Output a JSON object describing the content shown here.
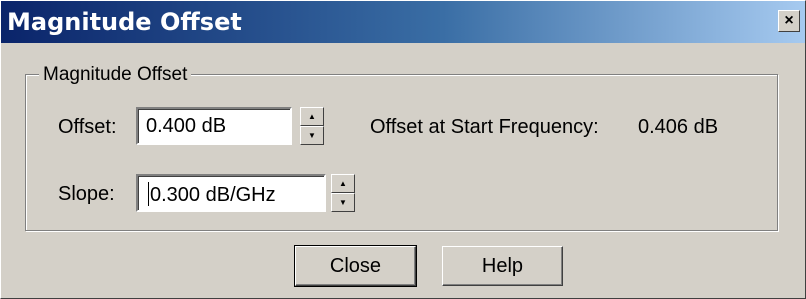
{
  "window": {
    "title": "Magnitude Offset",
    "close_glyph": "×"
  },
  "group": {
    "legend": "Magnitude Offset"
  },
  "offset": {
    "label": "Offset:",
    "value": "0.400 dB"
  },
  "slope": {
    "label": "Slope:",
    "value": "0.300 dB/GHz"
  },
  "start_frequency": {
    "label": "Offset at Start Frequency:",
    "value": "0.406 dB"
  },
  "buttons": {
    "close": "Close",
    "help": "Help"
  },
  "icons": {
    "spin_up": "▲",
    "spin_down": "▼"
  },
  "colors": {
    "title_gradient_start": "#0a246a",
    "title_gradient_end": "#a6caf0",
    "dialog_face": "#d4d0c8"
  }
}
